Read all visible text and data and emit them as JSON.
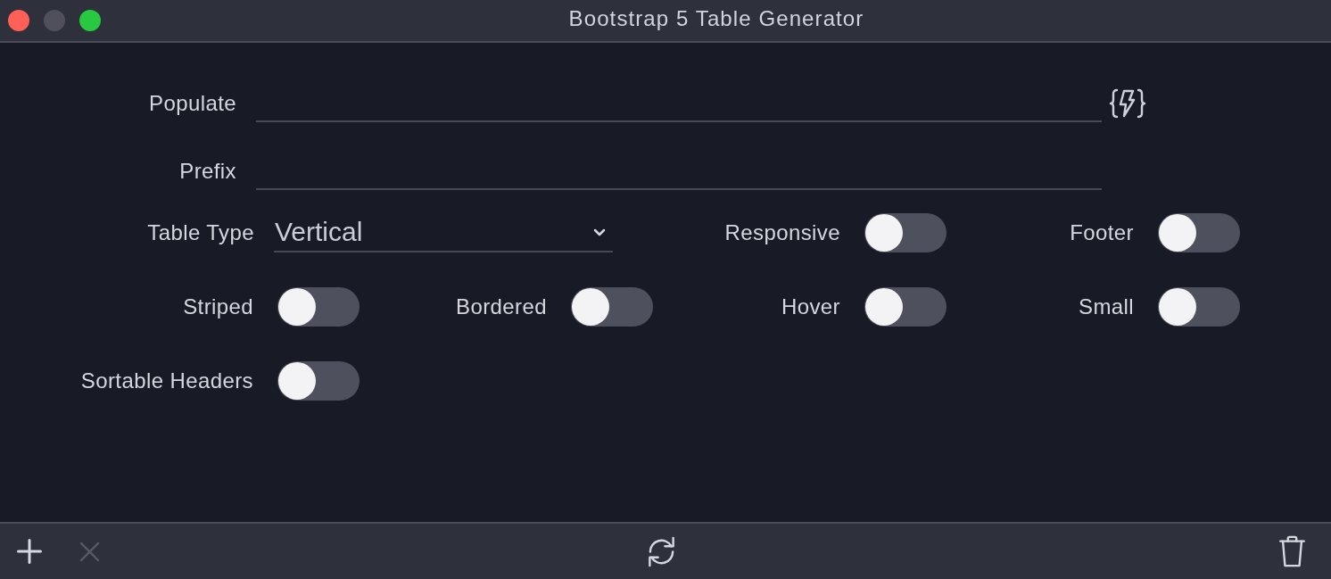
{
  "window": {
    "title": "Bootstrap 5 Table Generator",
    "controls": [
      {
        "kind": "close",
        "disabled": false
      },
      {
        "kind": "minimize",
        "disabled": true
      },
      {
        "kind": "zoom",
        "disabled": false
      }
    ]
  },
  "fields": [
    {
      "label": "Populate",
      "generate_button": true
    },
    {
      "label": "Prefix",
      "generate_button": false
    }
  ],
  "option_rows": [
    [
      {
        "kind": "select",
        "label": "Table Type",
        "value": "Vertical"
      },
      {
        "kind": "toggle",
        "label": "Responsive",
        "on": false
      },
      {
        "kind": "toggle",
        "label": "Footer",
        "on": false
      }
    ],
    [
      {
        "kind": "toggle",
        "label": "Striped",
        "on": false
      },
      {
        "kind": "toggle",
        "label": "Bordered",
        "on": false
      },
      {
        "kind": "toggle",
        "label": "Hover",
        "on": false
      },
      {
        "kind": "toggle",
        "label": "Small",
        "on": false
      }
    ],
    [
      {
        "kind": "toggle",
        "label": "Sortable Headers",
        "on": false
      }
    ]
  ],
  "toolbar": {
    "left": [
      {
        "kind": "add",
        "disabled": false
      },
      {
        "kind": "remove",
        "disabled": true
      }
    ],
    "center": [
      {
        "kind": "refresh",
        "disabled": false
      }
    ],
    "right": [
      {
        "kind": "delete",
        "disabled": false
      }
    ]
  }
}
